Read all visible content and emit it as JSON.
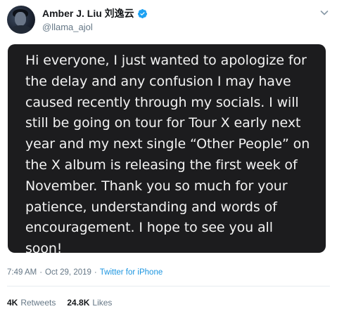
{
  "tweet": {
    "author": {
      "display_name": "Amber J. Liu 刘逸云",
      "handle": "@llama_ajol",
      "verified": true,
      "avatar_icon": "avatar-photo"
    },
    "menu_icon": "chevron-down-icon",
    "note_text": "Hi everyone, I just wanted to apologize for\nthe delay and any confusion I may have\ncaused recently through my socials. I will\nstill be going on tour for Tour X early next\nyear and my next single “Other People” on\nthe X album is releasing the first week of\nNovember. Thank you so much for your\npatience, understanding and words of\nencouragement. I hope to see you all\nsoon!",
    "time": "7:49 AM",
    "separator": "·",
    "date": "Oct 29, 2019",
    "source": "Twitter for iPhone",
    "stats": {
      "retweets_count": "4K",
      "retweets_label": "Retweets",
      "likes_count": "24.8K",
      "likes_label": "Likes"
    },
    "colors": {
      "accent": "#1b95e0",
      "verified": "#1da1f2",
      "note_background": "#1c1c1e",
      "secondary_text": "#657786"
    }
  }
}
